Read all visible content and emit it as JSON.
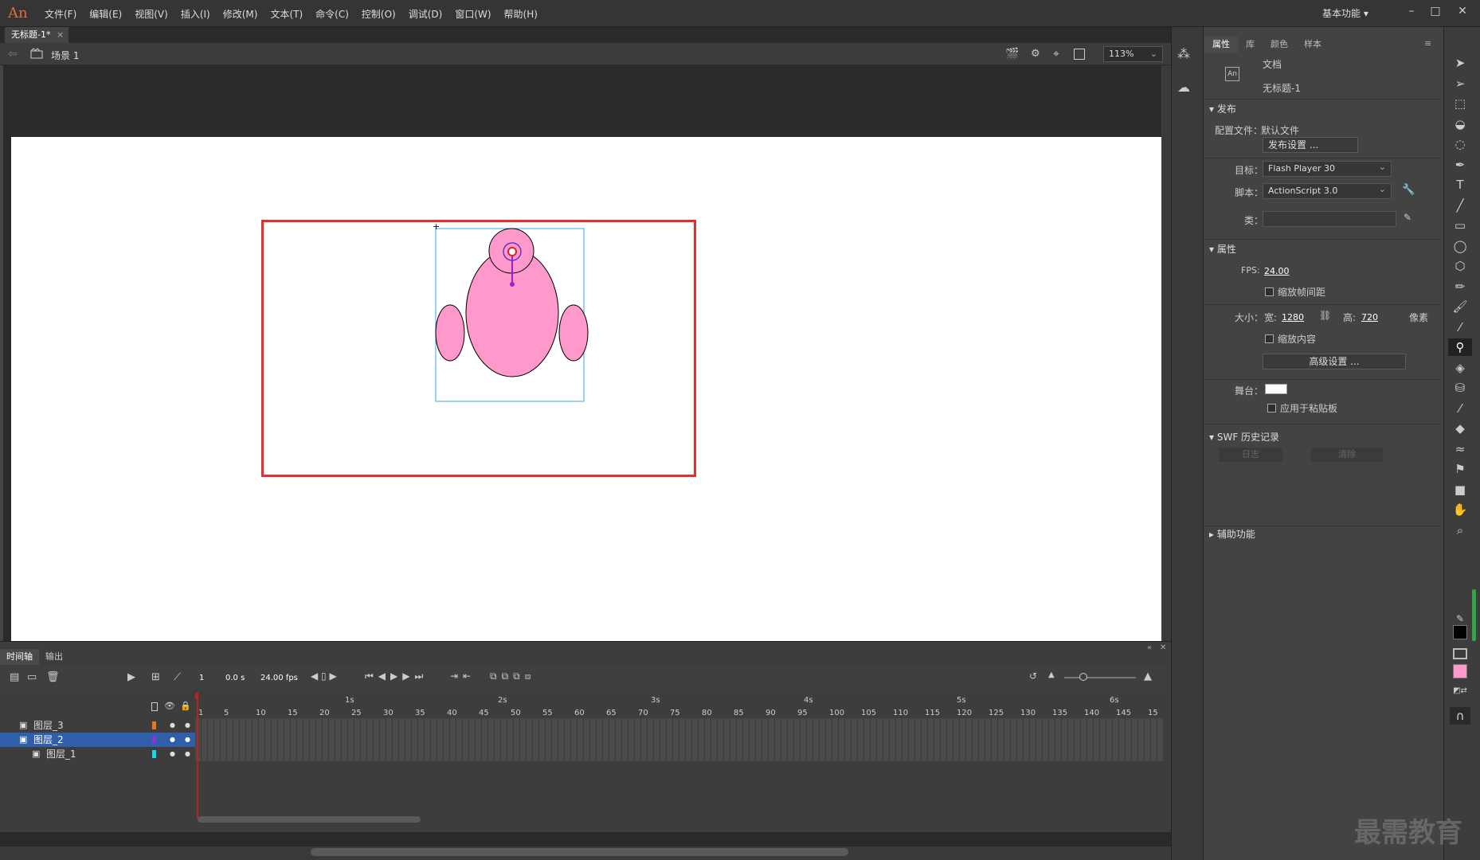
{
  "app": {
    "logo": "An"
  },
  "menu": [
    "文件(F)",
    "编辑(E)",
    "视图(V)",
    "插入(I)",
    "修改(M)",
    "文本(T)",
    "命令(C)",
    "控制(O)",
    "调试(D)",
    "窗口(W)",
    "帮助(H)"
  ],
  "workspace": "基本功能",
  "document": {
    "tab": "无标题-1*",
    "scene": "场景 1",
    "zoom": "113%"
  },
  "timeline": {
    "tabs": [
      "时间轴",
      "输出"
    ],
    "frame": "1",
    "time": "0.0 s",
    "fps": "24.00 fps",
    "seconds": [
      "1s",
      "2s",
      "3s",
      "4s",
      "5s",
      "6s"
    ],
    "ticks": [
      "1",
      "5",
      "10",
      "15",
      "20",
      "25",
      "30",
      "35",
      "40",
      "45",
      "50",
      "55",
      "60",
      "65",
      "70",
      "75",
      "80",
      "85",
      "90",
      "95",
      "100",
      "105",
      "110",
      "115",
      "120",
      "125",
      "130",
      "135",
      "140",
      "145",
      "15"
    ],
    "layers": [
      {
        "name": "图层_3",
        "color": "#e07b1f",
        "selected": false
      },
      {
        "name": "图层_2",
        "color": "#8a35d8",
        "selected": true
      },
      {
        "name": "图层_1",
        "color": "#18d8e8",
        "selected": false
      }
    ]
  },
  "properties": {
    "tabs": [
      "属性",
      "库",
      "颜色",
      "样本"
    ],
    "doc_type": "文档",
    "doc_name": "无标题-1",
    "publish": {
      "header": "发布",
      "profile_label": "配置文件：",
      "profile_value": "默认文件",
      "settings_button": "发布设置 ...",
      "target_label": "目标：",
      "target_value": "Flash Player 30",
      "script_label": "脚本：",
      "script_value": "ActionScript 3.0",
      "class_label": "类："
    },
    "attributes": {
      "header": "属性",
      "fps_label": "FPS:",
      "fps_value": "24.00",
      "scale_spacing": "缩放帧间距",
      "size_label": "大小：",
      "width_label": "宽:",
      "width_value": "1280",
      "height_label": "高:",
      "height_value": "720",
      "unit": "像素",
      "scale_content": "缩放内容",
      "advanced_button": "高级设置 ...",
      "stage_label": "舞台：",
      "apply_paste": "应用于粘贴板"
    },
    "swf": {
      "header": "SWF 历史记录",
      "log_button": "日志",
      "clear_button": "清除"
    },
    "accessibility": "辅助功能"
  },
  "colors": {
    "stage": "#ffffff",
    "shape_fill": "#ff99cc",
    "frame_border": "#e03030",
    "selection": "#33aaee",
    "fill_swatch": "#ff99cc",
    "stroke_swatch": "#000000"
  },
  "tools": [
    "selection-tool",
    "subselection-tool",
    "free-transform-tool",
    "3d-rotation-tool",
    "lasso-tool",
    "pen-tool",
    "text-tool",
    "line-tool",
    "rectangle-tool",
    "oval-tool",
    "polystar-tool",
    "pencil-tool",
    "paint-brush-tool",
    "brush-tool",
    "bone-tool",
    "paint-bucket-tool",
    "ink-bottle-tool",
    "eyedropper-tool",
    "eraser-tool",
    "width-tool",
    "asset-warp-tool",
    "camera-tool",
    "hand-tool",
    "zoom-tool"
  ],
  "watermark": "最需教育"
}
